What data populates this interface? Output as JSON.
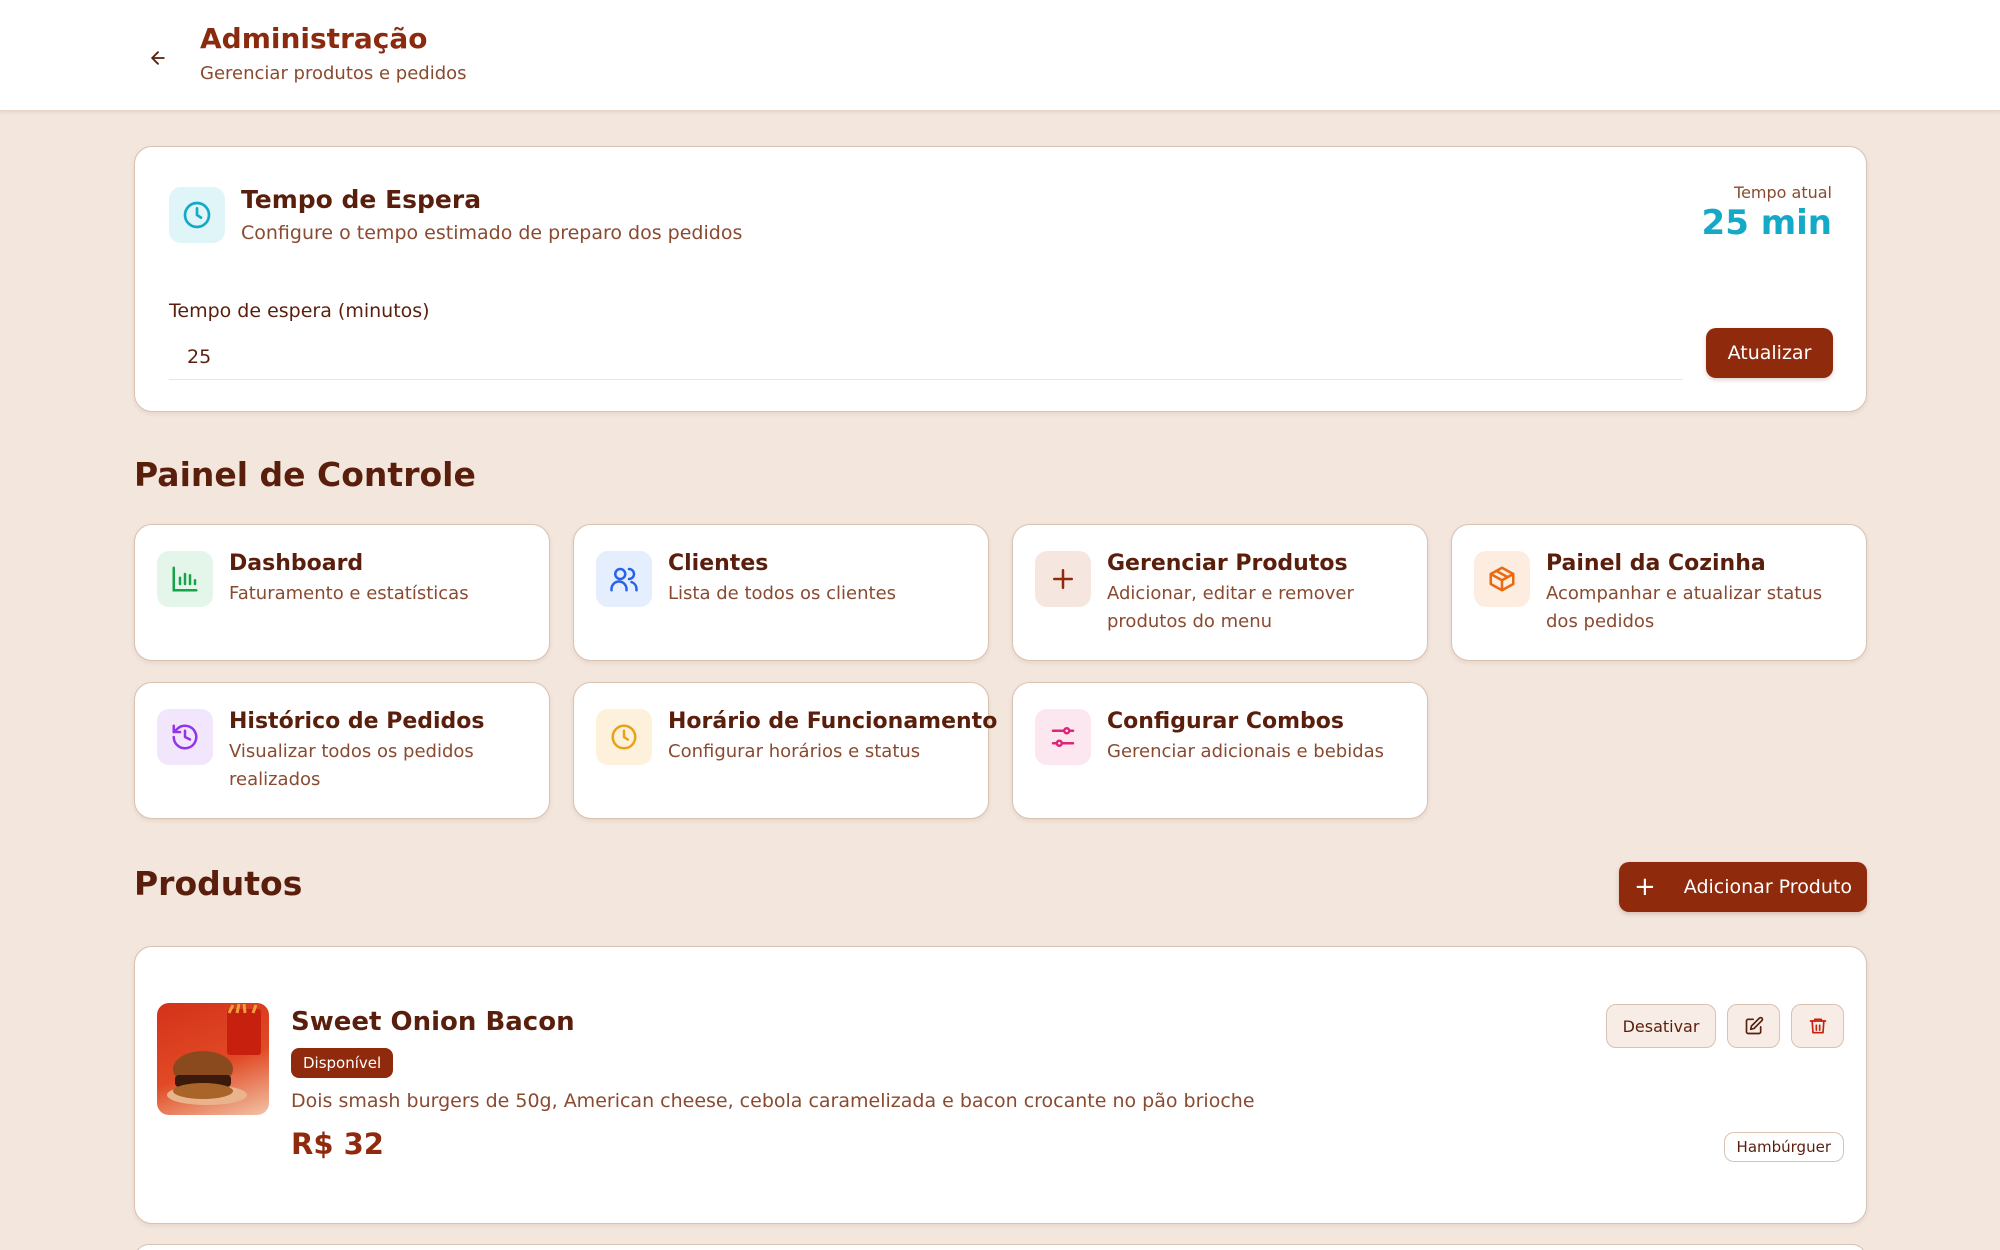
{
  "header": {
    "title": "Administração",
    "subtitle": "Gerenciar produtos e pedidos"
  },
  "wait_time": {
    "title": "Tempo de Espera",
    "subtitle": "Configure o tempo estimado de preparo dos pedidos",
    "current_label": "Tempo atual",
    "current_value": "25 min",
    "field_label": "Tempo de espera (minutos)",
    "field_value": "25",
    "update_label": "Atualizar"
  },
  "control_panel": {
    "title": "Painel de Controle",
    "tiles": [
      {
        "title": "Dashboard",
        "desc": "Faturamento e estatísticas",
        "icon": "bar-chart-icon",
        "color": "#16a34a",
        "bg": "#e3f6e9"
      },
      {
        "title": "Clientes",
        "desc": "Lista de todos os clientes",
        "icon": "users-icon",
        "color": "#2563eb",
        "bg": "#e5eefc"
      },
      {
        "title": "Gerenciar Produtos",
        "desc": "Adicionar, editar e remover produtos do menu",
        "icon": "plus-icon",
        "color": "#8f2a0c",
        "bg": "#f6e6e0"
      },
      {
        "title": "Painel da Cozinha",
        "desc": "Acompanhar e atualizar status dos pedidos",
        "icon": "package-icon",
        "color": "#ea6a10",
        "bg": "#fdece0"
      },
      {
        "title": "Histórico de Pedidos",
        "desc": "Visualizar todos os pedidos realizados",
        "icon": "history-icon",
        "color": "#9333ea",
        "bg": "#f1e6fb"
      },
      {
        "title": "Horário de Funcionamento",
        "desc": "Configurar horários e status",
        "icon": "clock-icon",
        "color": "#e9a116",
        "bg": "#fdf1dc"
      },
      {
        "title": "Configurar Combos",
        "desc": "Gerenciar adicionais e bebidas",
        "icon": "sliders-icon",
        "color": "#db2777",
        "bg": "#fce6f0"
      }
    ]
  },
  "products": {
    "title": "Produtos",
    "add_label": "Adicionar Produto",
    "items": [
      {
        "name": "Sweet Onion Bacon",
        "status": "Disponível",
        "description": "Dois smash burgers de 50g, American cheese, cebola caramelizada e bacon crocante no pão brioche",
        "price": "R$ 32",
        "category": "Hambúrguer",
        "deactivate_label": "Desativar"
      }
    ]
  },
  "colors": {
    "accent": "#8f2a0c",
    "background": "#f3e6dc",
    "highlight": "#14a9c7"
  }
}
